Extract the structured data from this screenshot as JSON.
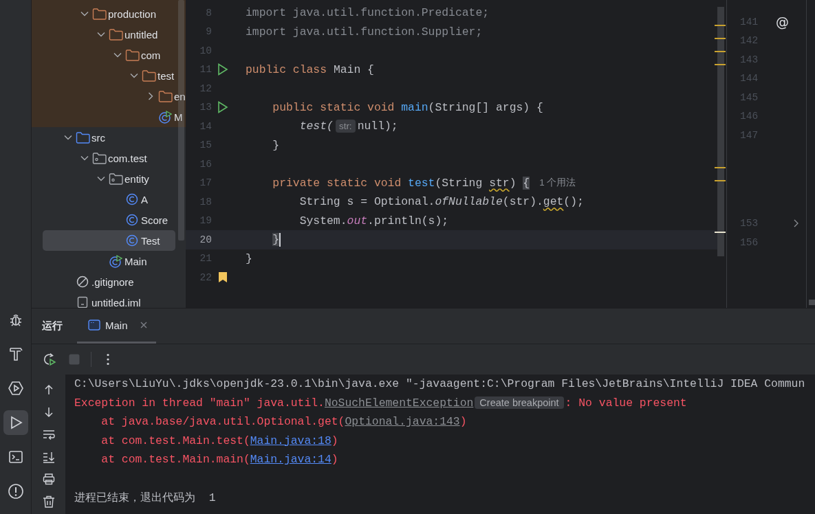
{
  "tool_strip": [
    {
      "kind": "debug",
      "selected": false
    },
    {
      "kind": "build",
      "selected": false
    },
    {
      "kind": "services",
      "selected": false
    },
    {
      "kind": "run",
      "selected": true
    },
    {
      "kind": "terminal",
      "selected": false
    },
    {
      "kind": "problems",
      "selected": false
    }
  ],
  "project_tree": {
    "sections": [
      {
        "kind": "excluded",
        "items": [
          {
            "label": "production",
            "kind": "folder",
            "expanded": true,
            "selected": false,
            "children": [
              {
                "label": "untitled",
                "kind": "folder",
                "expanded": true,
                "selected": false,
                "children": [
                  {
                    "label": "com",
                    "kind": "folder",
                    "expanded": true,
                    "selected": false,
                    "children": [
                      {
                        "label": "test",
                        "kind": "folder",
                        "expanded": true,
                        "selected": false,
                        "children": [
                          {
                            "label": "en",
                            "kind": "folder",
                            "expanded": false,
                            "selected": false
                          },
                          {
                            "label": "M",
                            "kind": "main-class",
                            "selected": false
                          }
                        ]
                      }
                    ]
                  }
                ]
              }
            ]
          }
        ]
      },
      {
        "kind": "source",
        "items": [
          {
            "label": "src",
            "kind": "source-folder",
            "expanded": true,
            "selected": false,
            "children": [
              {
                "label": "com.test",
                "kind": "package",
                "expanded": true,
                "selected": false,
                "children": [
                  {
                    "label": "entity",
                    "kind": "package",
                    "expanded": true,
                    "selected": false,
                    "children": [
                      {
                        "label": "A",
                        "kind": "class",
                        "selected": false
                      },
                      {
                        "label": "Score",
                        "kind": "class",
                        "selected": false
                      },
                      {
                        "label": "Test",
                        "kind": "class",
                        "selected": true
                      }
                    ]
                  },
                  {
                    "label": "Main",
                    "kind": "main-class",
                    "selected": false
                  }
                ]
              }
            ]
          },
          {
            "label": ".gitignore",
            "kind": "ignore-file",
            "selected": false
          },
          {
            "label": "untitled.iml",
            "kind": "module-file",
            "selected": false
          }
        ]
      }
    ]
  },
  "editor": {
    "lines": [
      {
        "number": "8",
        "current": false,
        "tokens": [
          {
            "text": "import java.util.function.Predicate;",
            "kind": "unused"
          }
        ]
      },
      {
        "number": "9",
        "current": false,
        "tokens": [
          {
            "text": "import java.util.function.Supplier;",
            "kind": "unused"
          }
        ]
      },
      {
        "number": "10",
        "current": false
      },
      {
        "number": "11",
        "current": false,
        "gutter": {
          "kind": "run"
        },
        "tokens": [
          {
            "text": "public class ",
            "kind": "keyword"
          },
          {
            "text": "Main {",
            "kind": "plain"
          }
        ]
      },
      {
        "number": "12",
        "current": false
      },
      {
        "number": "13",
        "current": false,
        "gutter": {
          "kind": "run"
        },
        "tokens": [
          {
            "text": "    public static void ",
            "kind": "keyword"
          },
          {
            "text": "main",
            "kind": "method"
          },
          {
            "text": "(String[] args) {",
            "kind": "plain"
          }
        ]
      },
      {
        "number": "14",
        "current": false,
        "tokens": [
          {
            "text": "        test(",
            "kind": "italic"
          },
          {
            "text": "str:",
            "kind": "inlay"
          },
          {
            "text": "null);",
            "kind": "plain"
          }
        ]
      },
      {
        "number": "15",
        "current": false,
        "tokens": [
          {
            "text": "    }",
            "kind": "plain"
          }
        ]
      },
      {
        "number": "16",
        "current": false
      },
      {
        "number": "17",
        "current": false,
        "tokens": [
          {
            "text": "    private static void ",
            "kind": "keyword"
          },
          {
            "text": "test",
            "kind": "method"
          },
          {
            "text": "(String ",
            "kind": "plain"
          },
          {
            "text": "str",
            "kind": "warning"
          },
          {
            "text": ") ",
            "kind": "plain"
          },
          {
            "text": "{",
            "kind": "brace-match"
          },
          {
            "text": "1 个用法",
            "kind": "usage"
          }
        ]
      },
      {
        "number": "18",
        "current": false,
        "tokens": [
          {
            "text": "        String s = Optional.",
            "kind": "plain"
          },
          {
            "text": "ofNullable",
            "kind": "italic"
          },
          {
            "text": "(str).",
            "kind": "plain"
          },
          {
            "text": "get",
            "kind": "warning"
          },
          {
            "text": "();",
            "kind": "plain"
          }
        ]
      },
      {
        "number": "19",
        "current": false,
        "tokens": [
          {
            "text": "        System.",
            "kind": "plain"
          },
          {
            "text": "out",
            "kind": "field"
          },
          {
            "text": ".println(s);",
            "kind": "plain"
          }
        ]
      },
      {
        "number": "20",
        "current": true,
        "tokens": [
          {
            "text": "    }",
            "kind": "brace-match-end"
          }
        ]
      },
      {
        "number": "21",
        "current": false,
        "tokens": [
          {
            "text": "}",
            "kind": "plain"
          }
        ]
      },
      {
        "number": "22",
        "current": false,
        "gutter": {
          "kind": "bookmark"
        }
      }
    ]
  },
  "side_gutter": {
    "top_lines": [
      {
        "number": "141",
        "annotation": "@",
        "foldable": false
      },
      {
        "number": "142",
        "foldable": false
      },
      {
        "number": "143",
        "foldable": false
      },
      {
        "number": "144",
        "foldable": false
      },
      {
        "number": "145",
        "foldable": false
      },
      {
        "number": "146",
        "foldable": false
      },
      {
        "number": "147",
        "foldable": false
      }
    ],
    "bottom_lines": [
      {
        "number": "153",
        "foldable": true
      },
      {
        "number": "156",
        "foldable": false
      }
    ]
  },
  "run_panel": {
    "title": "运行",
    "tabs": [
      {
        "label": "Main",
        "selected": true
      }
    ],
    "toolbar": [
      {
        "kind": "rerun",
        "disabled": false
      },
      {
        "kind": "stop",
        "disabled": true
      },
      {
        "kind": "more",
        "disabled": false
      }
    ],
    "console_tools": [
      {
        "kind": "up"
      },
      {
        "kind": "down"
      },
      {
        "kind": "wrap"
      },
      {
        "kind": "scroll-end"
      },
      {
        "kind": "print"
      },
      {
        "kind": "clear"
      }
    ],
    "console": [
      {
        "blank_line_before": false,
        "segments": [
          {
            "text": "C:\\Users\\LiuYu\\.jdks\\openjdk-23.0.1\\bin\\java.exe \"-javaagent:C:\\Program Files\\JetBrains\\IntelliJ IDEA Commun",
            "kind": "plain"
          }
        ]
      },
      {
        "blank_line_before": false,
        "segments": [
          {
            "text": "Exception in thread \"main\" java.util.",
            "kind": "error"
          },
          {
            "text": "NoSuchElementException",
            "kind": "muted-link"
          },
          {
            "text": "Create breakpoint",
            "kind": "chip"
          },
          {
            "text": ": No value present",
            "kind": "error"
          }
        ]
      },
      {
        "blank_line_before": false,
        "segments": [
          {
            "text": "    at java.base/java.util.Optional.get(",
            "kind": "error"
          },
          {
            "text": "Optional.java:143",
            "kind": "muted-link"
          },
          {
            "text": ")",
            "kind": "error"
          }
        ]
      },
      {
        "blank_line_before": false,
        "segments": [
          {
            "text": "    at com.test.Main.test(",
            "kind": "error"
          },
          {
            "text": "Main.java:18",
            "kind": "link"
          },
          {
            "text": ")",
            "kind": "error"
          }
        ]
      },
      {
        "blank_line_before": false,
        "segments": [
          {
            "text": "    at com.test.Main.main(",
            "kind": "error"
          },
          {
            "text": "Main.java:14",
            "kind": "link"
          },
          {
            "text": ")",
            "kind": "error"
          }
        ]
      },
      {
        "blank_line_before": true,
        "segments": [
          {
            "text": "进程已结束，退出代码为  1",
            "kind": "plain"
          }
        ]
      }
    ]
  }
}
